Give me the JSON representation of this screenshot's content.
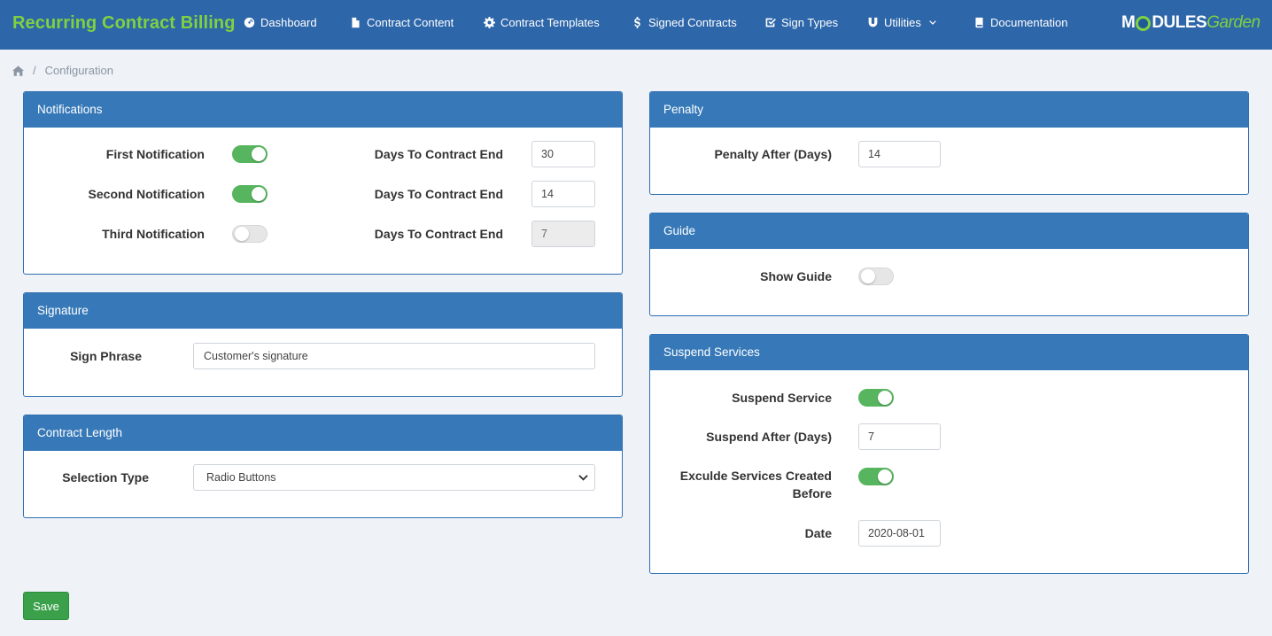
{
  "app": {
    "title": "Recurring Contract Billing"
  },
  "nav": {
    "items": [
      {
        "label": "Dashboard",
        "icon": "dashboard-icon"
      },
      {
        "label": "Contract Content",
        "icon": "file-icon"
      },
      {
        "label": "Contract Templates",
        "icon": "gear-icon"
      },
      {
        "label": "Signed Contracts",
        "icon": "dollar-icon"
      },
      {
        "label": "Sign Types",
        "icon": "check-square-icon"
      },
      {
        "label": "Utilities",
        "icon": "magnet-icon"
      },
      {
        "label": "Documentation",
        "icon": "book-icon"
      }
    ],
    "logo": {
      "part1": "M",
      "part2": "DULES",
      "part3": "Garden"
    }
  },
  "breadcrumb": {
    "separator": "/",
    "current": "Configuration"
  },
  "notifications": {
    "title": "Notifications",
    "rows": [
      {
        "label": "First Notification",
        "enabled": true,
        "days_label": "Days To Contract End",
        "days": "30",
        "disabled": false
      },
      {
        "label": "Second Notification",
        "enabled": true,
        "days_label": "Days To Contract End",
        "days": "14",
        "disabled": false
      },
      {
        "label": "Third Notification",
        "enabled": false,
        "days_label": "Days To Contract End",
        "days": "7",
        "disabled": true
      }
    ]
  },
  "signature": {
    "title": "Signature",
    "label": "Sign Phrase",
    "value": "Customer's signature"
  },
  "contract_length": {
    "title": "Contract Length",
    "label": "Selection Type",
    "value": "Radio Buttons"
  },
  "penalty": {
    "title": "Penalty",
    "label": "Penalty After (Days)",
    "value": "14"
  },
  "guide": {
    "title": "Guide",
    "label": "Show Guide",
    "enabled": false
  },
  "suspend": {
    "title": "Suspend Services",
    "suspend_label": "Suspend Service",
    "suspend_enabled": true,
    "after_label": "Suspend After (Days)",
    "after_value": "7",
    "exclude_label_1": "Exculde Services Created",
    "exclude_label_2": "Before",
    "exclude_enabled": true,
    "date_label": "Date",
    "date_value": "2020-08-01"
  },
  "actions": {
    "save_label": "Save"
  },
  "colors": {
    "header": "#2d66a9",
    "panel_head": "#3779b8",
    "accent_green": "#57b55f",
    "brand_green": "#7fd141"
  }
}
